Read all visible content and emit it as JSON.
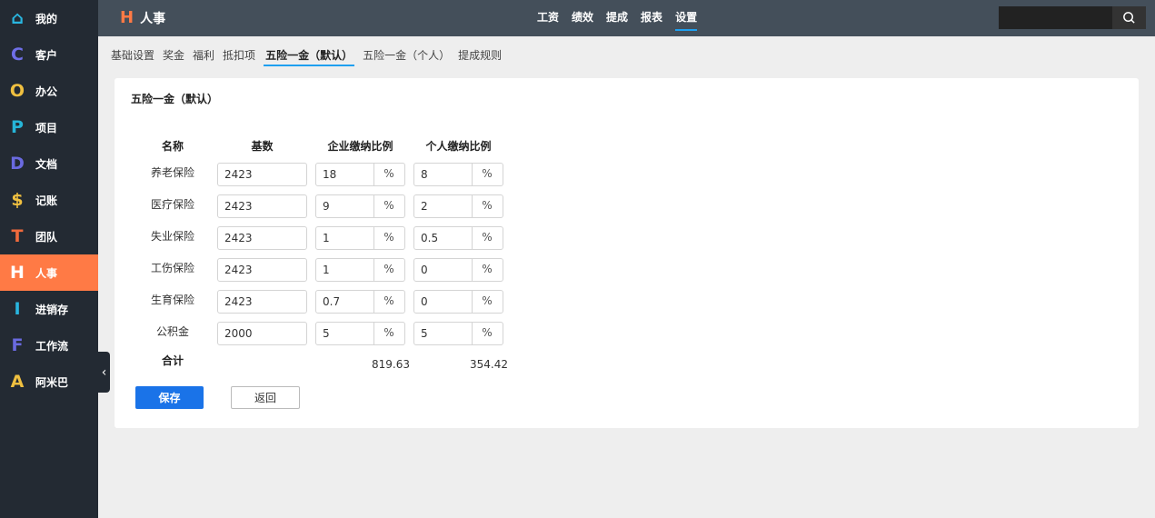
{
  "sidebar": {
    "items": [
      {
        "icon": "⌂",
        "label": "我的",
        "color": "#29b6e0",
        "name": "home"
      },
      {
        "icon": "C",
        "label": "客户",
        "color": "#6f6fe8",
        "name": "letter-c"
      },
      {
        "icon": "O",
        "label": "办公",
        "color": "#f0c040",
        "name": "letter-o"
      },
      {
        "icon": "P",
        "label": "项目",
        "color": "#26b5d8",
        "name": "letter-p"
      },
      {
        "icon": "D",
        "label": "文档",
        "color": "#6a6ae0",
        "name": "letter-d"
      },
      {
        "icon": "$",
        "label": "记账",
        "color": "#f0c040",
        "name": "dollar"
      },
      {
        "icon": "T",
        "label": "团队",
        "color": "#f06a3c",
        "name": "letter-t"
      },
      {
        "icon": "H",
        "label": "人事",
        "color": "#ffffff",
        "name": "letter-h"
      },
      {
        "icon": "I",
        "label": "进销存",
        "color": "#29b6e0",
        "name": "letter-i"
      },
      {
        "icon": "F",
        "label": "工作流",
        "color": "#6a6ae0",
        "name": "letter-f"
      },
      {
        "icon": "A",
        "label": "阿米巴",
        "color": "#f0c040",
        "name": "letter-a"
      }
    ],
    "active_index": 7,
    "collapse_icon": "‹"
  },
  "header": {
    "logo_letter": "H",
    "title": "人事",
    "nav": [
      "工资",
      "绩效",
      "提成",
      "报表",
      "设置"
    ],
    "active_nav": 4,
    "search_value": "",
    "search_icon": "⌕"
  },
  "tabs": {
    "items": [
      "基础设置",
      "奖金",
      "福利",
      "抵扣项",
      "五险一金（默认）",
      "五险一金（个人）",
      "提成规则"
    ],
    "active_index": 4
  },
  "card": {
    "title": "五险一金（默认）",
    "columns": [
      "名称",
      "基数",
      "企业缴纳比例",
      "个人缴纳比例"
    ],
    "percent_unit": "%",
    "rows": [
      {
        "name": "养老保险",
        "base": "2423",
        "company": "18",
        "personal": "8"
      },
      {
        "name": "医疗保险",
        "base": "2423",
        "company": "9",
        "personal": "2"
      },
      {
        "name": "失业保险",
        "base": "2423",
        "company": "1",
        "personal": "0.5"
      },
      {
        "name": "工伤保险",
        "base": "2423",
        "company": "1",
        "personal": "0"
      },
      {
        "name": "生育保险",
        "base": "2423",
        "company": "0.7",
        "personal": "0"
      },
      {
        "name": "公积金",
        "base": "2000",
        "company": "5",
        "personal": "5"
      }
    ],
    "total_label": "合计",
    "total_company": "819.63",
    "total_personal": "354.42",
    "save_label": "保存",
    "back_label": "返回"
  },
  "colors": {
    "accent": "#1a73e8",
    "active_sidebar": "#ff7a45",
    "tab_underline": "#1ea0f0"
  }
}
